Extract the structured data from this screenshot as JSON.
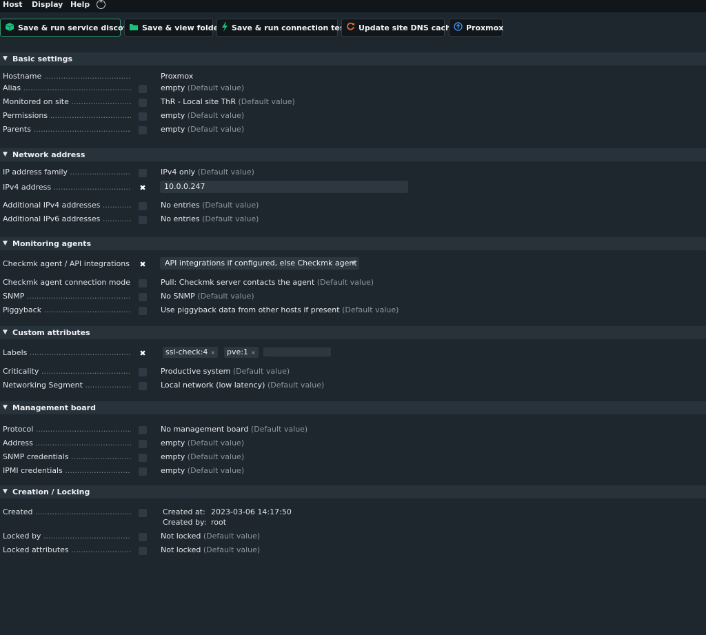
{
  "menu": [
    "Host",
    "Display",
    "Help"
  ],
  "toolbar": {
    "discovery": "Save & run service discovery",
    "folder": "Save & view folder",
    "tests": "Save & run connection tests",
    "dns": "Update site DNS cache",
    "proxmox": "Proxmox"
  },
  "colors": {
    "accent": "#2a9a6a",
    "bg": "#1e262e",
    "header": "#28323b"
  },
  "sections": {
    "basic": {
      "title": "Basic settings",
      "hostname": {
        "label": "Hostname",
        "value": "Proxmox"
      },
      "alias": {
        "label": "Alias",
        "value": "empty",
        "def": "(Default value)"
      },
      "site": {
        "label": "Monitored on site",
        "value": "ThR - Local site ThR",
        "def": "(Default value)"
      },
      "permissions": {
        "label": "Permissions",
        "value": "empty",
        "def": "(Default value)"
      },
      "parents": {
        "label": "Parents",
        "value": "empty",
        "def": "(Default value)"
      }
    },
    "network": {
      "title": "Network address",
      "family": {
        "label": "IP address family",
        "value": "IPv4 only",
        "def": "(Default value)"
      },
      "ipv4": {
        "label": "IPv4 address",
        "value": "10.0.0.247"
      },
      "add4": {
        "label": "Additional IPv4 addresses",
        "value": "No entries",
        "def": "(Default value)"
      },
      "add6": {
        "label": "Additional IPv6 addresses",
        "value": "No entries",
        "def": "(Default value)"
      }
    },
    "agents": {
      "title": "Monitoring agents",
      "api": {
        "label": "Checkmk agent / API integrations",
        "value": "API integrations if configured, else Checkmk agent"
      },
      "mode": {
        "label": "Checkmk agent connection mode",
        "value": "Pull: Checkmk server contacts the agent",
        "def": "(Default value)"
      },
      "snmp": {
        "label": "SNMP",
        "value": "No SNMP",
        "def": "(Default value)"
      },
      "piggy": {
        "label": "Piggyback",
        "value": "Use piggyback data from other hosts if present",
        "def": "(Default value)"
      }
    },
    "custom": {
      "title": "Custom attributes",
      "labels": {
        "label": "Labels",
        "tags": [
          "ssl-check:4",
          "pve:1"
        ]
      },
      "criticality": {
        "label": "Criticality",
        "value": "Productive system",
        "def": "(Default value)"
      },
      "segment": {
        "label": "Networking Segment",
        "value": "Local network (low latency)",
        "def": "(Default value)"
      }
    },
    "mgmt": {
      "title": "Management board",
      "protocol": {
        "label": "Protocol",
        "value": "No management board",
        "def": "(Default value)"
      },
      "address": {
        "label": "Address",
        "value": "empty",
        "def": "(Default value)"
      },
      "snmpcred": {
        "label": "SNMP credentials",
        "value": "empty",
        "def": "(Default value)"
      },
      "ipmi": {
        "label": "IPMI credentials",
        "value": "empty",
        "def": "(Default value)"
      }
    },
    "creation": {
      "title": "Creation / Locking",
      "created": {
        "label": "Created",
        "at_label": "Created at:",
        "at": "2023-03-06 14:17:50",
        "by_label": "Created by:",
        "by": "root"
      },
      "lockedby": {
        "label": "Locked by",
        "value": "Not locked",
        "def": "(Default value)"
      },
      "lockedattr": {
        "label": "Locked attributes",
        "value": "Not locked",
        "def": "(Default value)"
      }
    }
  }
}
